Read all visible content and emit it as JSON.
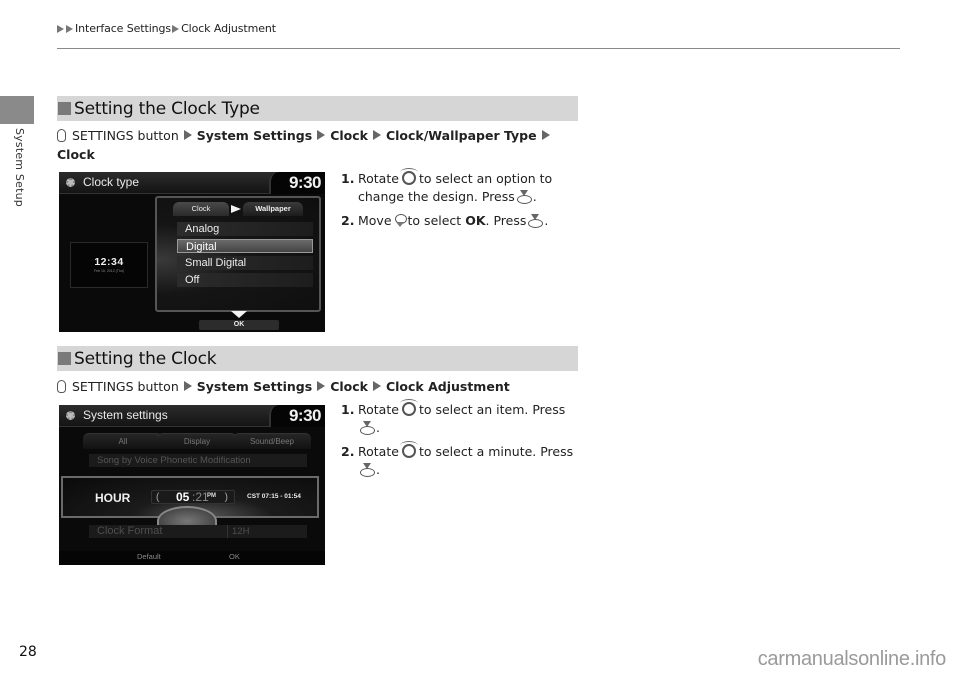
{
  "header": {
    "breadcrumb": [
      "Interface Settings",
      "Clock Adjustment"
    ]
  },
  "sidebar": {
    "label": "System Setup"
  },
  "sections": [
    {
      "title": "Setting the Clock Type",
      "path": {
        "prefix": "SETTINGS button",
        "items": [
          "System Settings",
          "Clock",
          "Clock/Wallpaper Type",
          "Clock"
        ]
      },
      "screen": {
        "title": "Clock type",
        "time": "9:30",
        "preview_time": "12:34",
        "preview_date": "Feb 16, 2012 (Thu)",
        "tabs": [
          "Clock",
          "Wallpaper"
        ],
        "options": [
          "Analog",
          "Digital",
          "Small Digital",
          "Off"
        ],
        "selected_option": "Digital",
        "ok_label": "OK"
      },
      "steps": [
        {
          "num": "1.",
          "text_a": "Rotate",
          "text_b": "to select an option to change the design. Press",
          "text_c": "."
        },
        {
          "num": "2.",
          "text_a": "Move",
          "text_b": "to select",
          "bold": "OK",
          "text_c": ". Press",
          "text_d": "."
        }
      ]
    },
    {
      "title": "Setting the Clock",
      "path": {
        "prefix": "SETTINGS button",
        "items": [
          "System Settings",
          "Clock",
          "Clock Adjustment"
        ]
      },
      "screen": {
        "title": "System settings",
        "time": "9:30",
        "tabs": [
          "All",
          "Display",
          "Sound/Beep"
        ],
        "row_top": "Song by Voice Phonetic Modification",
        "hour_label": "HOUR",
        "hour_value": "05",
        "minute_value": ":21",
        "ampm": "PM",
        "dst_range": "CST 07:15 - 01:54",
        "row_bottom": "Clock Format",
        "row_bottom_value": "12H",
        "bottom_buttons": [
          "Default",
          "OK"
        ]
      },
      "steps": [
        {
          "num": "1.",
          "text_a": "Rotate",
          "text_b": "to select an item. Press",
          "text_c": "."
        },
        {
          "num": "2.",
          "text_a": "Rotate",
          "text_b": "to select a minute. Press",
          "text_c": "."
        }
      ]
    }
  ],
  "footer": {
    "page_number": "28",
    "watermark": "carmanualsonline.info"
  }
}
